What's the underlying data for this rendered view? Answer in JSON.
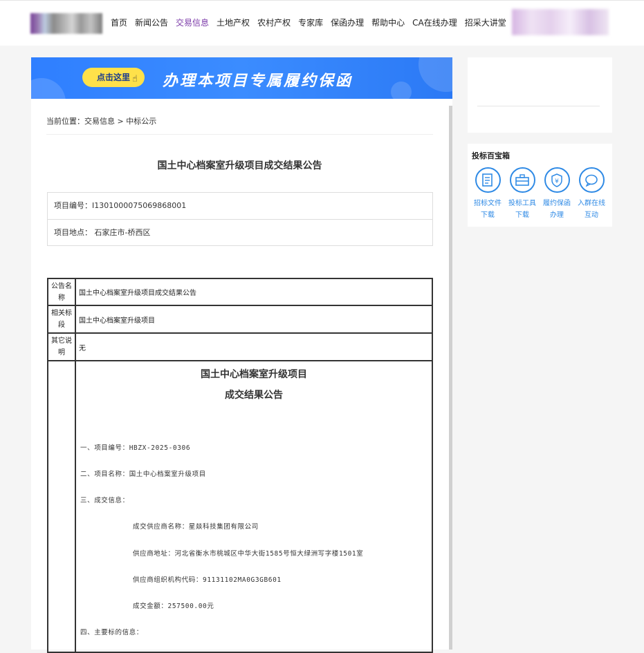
{
  "nav": {
    "items": [
      "首页",
      "新闻公告",
      "交易信息",
      "土地产权",
      "农村产权",
      "专家库",
      "保函办理",
      "帮助中心",
      "CA在线办理",
      "招采大讲堂"
    ],
    "active_index": 2,
    "active_color": "#7b3aa8"
  },
  "banner": {
    "button_label": "点击这里",
    "title": "办理本项目专属履约保函"
  },
  "breadcrumb": "当前位置：交易信息 > 中标公示",
  "page_title": "国土中心档案室升级项目成交结果公告",
  "project_info": {
    "number": "项目编号：I1301000075069868001",
    "location": "项目地点：  石家庄市-桥西区"
  },
  "notice_table": {
    "rows": [
      {
        "label": "公告名称",
        "value": "国土中心档案室升级项目成交结果公告"
      },
      {
        "label": "相关标段",
        "value": "国土中心档案室升级项目"
      },
      {
        "label": "其它说明",
        "value": "无"
      }
    ],
    "content": {
      "title_line1": "国土中心档案室升级项目",
      "title_line2": "成交结果公告",
      "lines": [
        "一、项目编号：HBZX-2025-0306",
        "二、项目名称：国土中心档案室升级项目",
        "三、成交信息：",
        "成交供应商名称：星燚科技集团有限公司",
        "供应商地址：河北省衡水市桃城区中华大街1585号恒大绿洲写字楼1501室",
        "供应商组织机构代码：91131102MA0G3GB601",
        "成交金额：257500.00元",
        "四、主要标的信息："
      ]
    }
  },
  "sidebar": {
    "toolbox_title": "投标百宝箱",
    "tools": [
      {
        "line1": "招标文件",
        "line2": "下载",
        "icon": "document-icon"
      },
      {
        "line1": "投标工具",
        "line2": "下载",
        "icon": "toolbox-icon"
      },
      {
        "line1": "履约保函",
        "line2": "办理",
        "icon": "yen-shield-icon"
      },
      {
        "line1": "入群在线",
        "line2": "互动",
        "icon": "chat-icon"
      }
    ],
    "accent_color": "#2f8ae5"
  }
}
